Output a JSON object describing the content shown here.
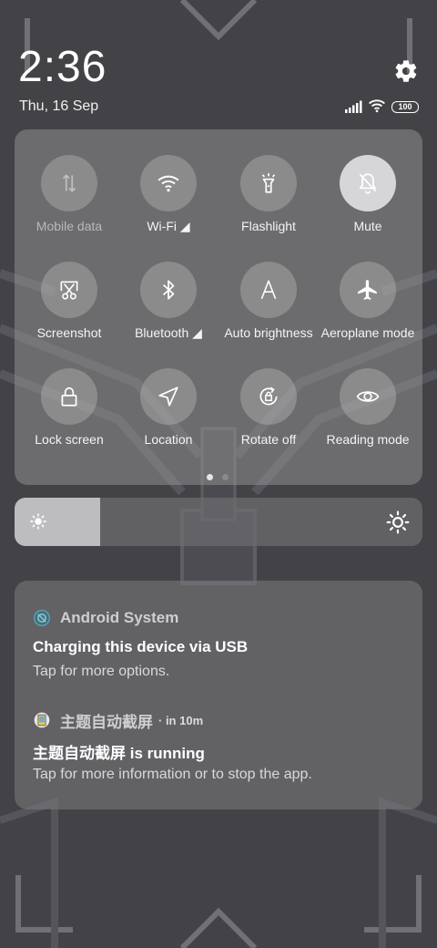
{
  "status_bar": {
    "time": "2:36",
    "date": "Thu, 16 Sep",
    "battery": "100",
    "icons": [
      "settings-gear-icon",
      "signal-icon",
      "wifi-icon",
      "battery-icon"
    ]
  },
  "quick_settings": {
    "tiles": [
      {
        "label": "Mobile data",
        "icon": "mobile-data-icon",
        "state": "unavailable"
      },
      {
        "label": "Wi-Fi ◢",
        "icon": "wifi-icon",
        "state": "off"
      },
      {
        "label": "Flashlight",
        "icon": "flashlight-icon",
        "state": "off"
      },
      {
        "label": "Mute",
        "icon": "bell-off-icon",
        "state": "on"
      },
      {
        "label": "Screenshot",
        "icon": "scissors-icon",
        "state": "off"
      },
      {
        "label": "Bluetooth ◢",
        "icon": "bluetooth-icon",
        "state": "off"
      },
      {
        "label": "Auto brightness",
        "icon": "auto-brightness-icon",
        "state": "off"
      },
      {
        "label": "Aeroplane mode",
        "icon": "airplane-icon",
        "state": "off"
      },
      {
        "label": "Lock screen",
        "icon": "lock-icon",
        "state": "off"
      },
      {
        "label": "Location",
        "icon": "location-arrow-icon",
        "state": "off"
      },
      {
        "label": "Rotate off",
        "icon": "rotation-lock-icon",
        "state": "off"
      },
      {
        "label": "Reading mode",
        "icon": "eye-icon",
        "state": "off"
      }
    ],
    "page_count": 2,
    "current_page": 1
  },
  "brightness": {
    "level": 0.21
  },
  "notifications": [
    {
      "app": "Android System",
      "icon": "android-system-icon",
      "time": "",
      "title": "Charging this device via USB",
      "text": "Tap for more options."
    },
    {
      "app": "主题自动截屏",
      "icon": "app-icon",
      "time": "· in 10m",
      "title": "主题自动截屏 is running",
      "text": "Tap for more information or to stop the app."
    }
  ],
  "colors": {
    "background": "#434347",
    "panel": "#8e8e90",
    "active_tile": "#d6d6d9",
    "brightness_fill": "#bdbdc0"
  }
}
